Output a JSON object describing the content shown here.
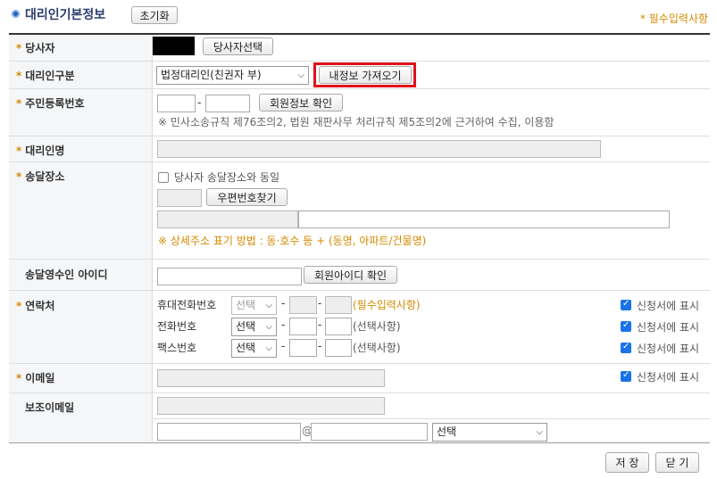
{
  "header": {
    "title": "대리인기본정보",
    "reset_label": "초기화",
    "required_note": "* 필수입력사항"
  },
  "rows": {
    "party": {
      "label": "당사자",
      "select_button": "당사자선택"
    },
    "agent_type": {
      "label": "대리인구분",
      "selected": "법정대리인(친권자 부)",
      "fetch_button": "내정보 가져오기"
    },
    "resident_no": {
      "label": "주민등록번호",
      "dash": "-",
      "check_button": "회원정보 확인",
      "note": "※ 민사소송규칙 제76조의2, 법원 재판사무 처리규칙 제5조의2에 근거하여 수집, 이용함"
    },
    "agent_name": {
      "label": "대리인명"
    },
    "delivery": {
      "label": "송달장소",
      "same_as_party": "당사자 송달장소와 동일",
      "zip_button": "우편번호찾기",
      "note": "※ 상세주소 표기 방법 : 동·호수 등 + (동명, 아파트/건물명)"
    },
    "recipient_id": {
      "label": "송달영수인 아이디",
      "check_button": "회원아이디 확인"
    },
    "contact": {
      "label": "연락처",
      "select_placeholder": "선택",
      "dash": "-",
      "show_on_app": "신청서에 표시",
      "lines": [
        {
          "name": "휴대전화번호",
          "hint": "(필수입력사항)"
        },
        {
          "name": "전화번호",
          "hint": "(선택사항)"
        },
        {
          "name": "팩스번호",
          "hint": "(선택사항)"
        }
      ]
    },
    "email": {
      "label": "이메일",
      "show_on_app": "신청서에 표시"
    },
    "sub_email": {
      "label": "보조이메일",
      "at": "@",
      "domain_select": "선택"
    }
  },
  "footer": {
    "save_label": "저 장",
    "close_label": "닫 기"
  }
}
